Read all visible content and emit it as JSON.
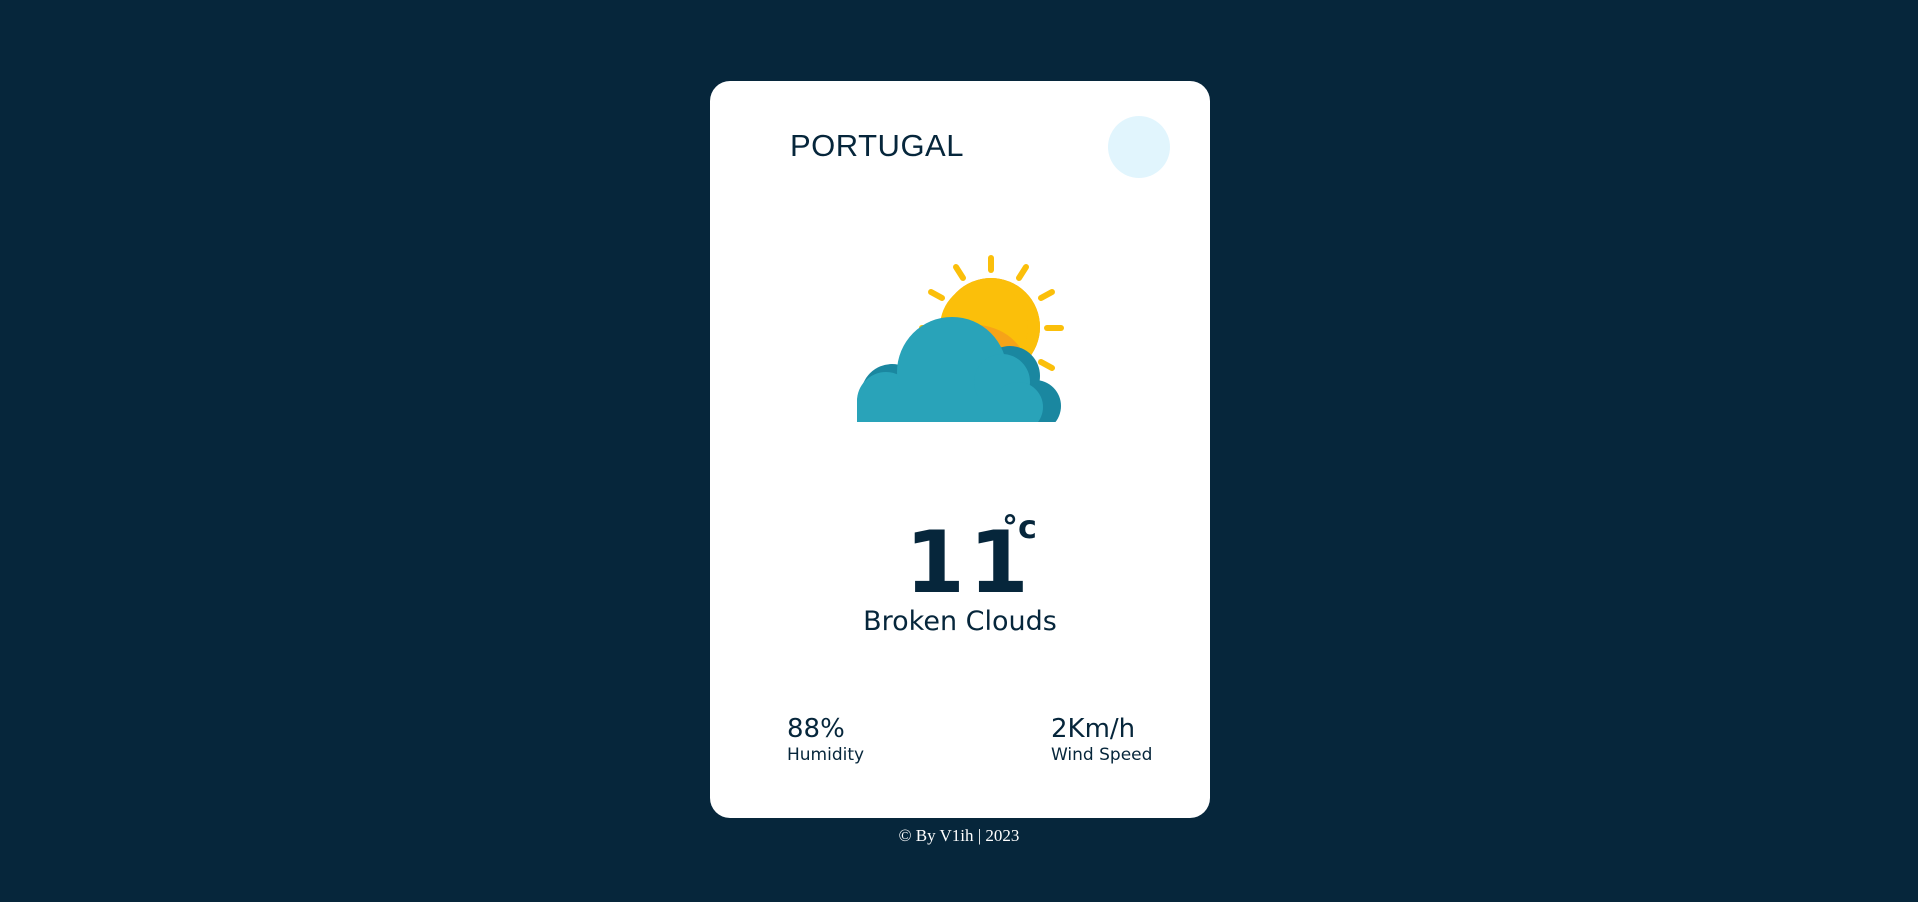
{
  "card": {
    "country": "PORTUGAL",
    "weather_icon": "sun-behind-cloud-icon",
    "temperature": "11",
    "temperature_unit": "°c",
    "description": "Broken Clouds",
    "humidity": {
      "value": "88%",
      "label": "Humidity"
    },
    "wind": {
      "value": "2Km/h",
      "label": "Wind Speed"
    }
  },
  "search_button": {
    "icon": "search-circle-icon"
  },
  "footer": {
    "text": "© By V1ih | 2023"
  },
  "colors": {
    "background": "#06263b",
    "card": "#ffffff",
    "text": "#06263b",
    "search_button": "#e1f5fd",
    "sun": "#fbbf0a",
    "sun_shadow": "#f59e1b",
    "cloud": "#29a3b9",
    "cloud_shadow": "#1a87a0"
  }
}
